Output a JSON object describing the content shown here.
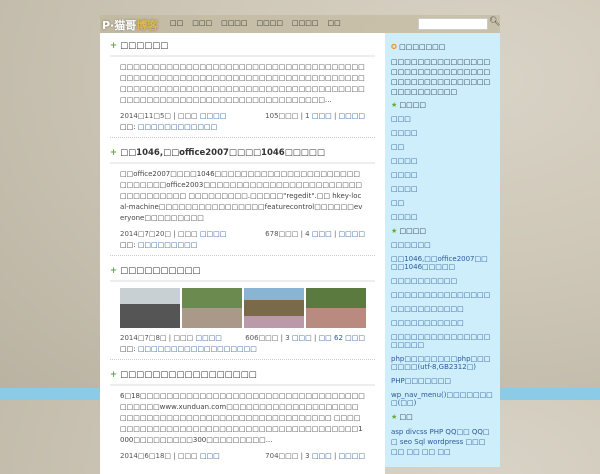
{
  "header": {
    "logo_left": "P·猫哥",
    "logo_right": "博客",
    "nav": [
      "□□",
      "□□□",
      "□□□□",
      "□□□□",
      "□□□□",
      "□□"
    ],
    "search_placeholder": ""
  },
  "posts": [
    {
      "title": "□□□□□□",
      "body": "□□□□□□□□□□□□□□□□□□□□□□□□□□□□□□□□□□□□□□□□□□□□□□□□□□□□□□□□□□□□□□□□□□□□□□□□□□□□□□□□□□□□□□□□□□□□□□□□□□□□□□□□□□□□□□□□□□□□□□□□□□□□□□□□□□□□□□□□□□□□□□...",
      "date": "2014□11□5□ | □□□ ",
      "author": "□□□□",
      "stats": "105□□□ | 1 ",
      "c1": "□□□",
      "c2": "□□□□",
      "tags_label": "□□: ",
      "tags": "□□□□□□□□□□□□"
    },
    {
      "title": "□□1046,□□office2007□□□□1046□□□□□",
      "body": "□□office2007□□□□1046□□□□□□□□□□□□□□□□□□□□□□□□□□□□□office2003□□□□□□□□□□□□□□□□□□□□□□□□□□□□□□□□□□ □□□□□□□□□.□□□□□\"regedit\".□□ hkey-local-machine□□□□□□□□□□□□□□□□featurecontrol□□□□□□everyone□□□□□□□□□",
      "date": "2014□7□20□ | □□□ ",
      "author": "□□□□",
      "stats": "678□□□ | 4 ",
      "c1": "□□□",
      "c2": "□□□□",
      "tags_label": "□□: ",
      "tags": "□□□□□□□□□"
    },
    {
      "title": "□□□□□□□□□□",
      "date": "2014□7□8□ | □□□ ",
      "author": "□□□□",
      "stats": "606□□□ | 3 ",
      "c1": "□□□",
      "c2": "□□ 62 □□□",
      "tags_label": "□□: ",
      "tags": "□□□□□□□□□□□□□□□□□□"
    },
    {
      "title": "□□□□□□□□□□□□□□□□□",
      "body": "6□18□□□□□□□□□□□□□□□□□□□□□□□□□□□□□□□□□□□□□□□□www.xunduan.com□□□□□□□□□□□□□□□□□□□□□□□□□□□□□□□□□□□□□□□□□□□□□□□□□□□□ □□□□□□□□□□□□□□□□□□□□□□□□□□□□□□□□□□□□□□□□1000□□□□□□□□□300□□□□□□□□□...",
      "date": "2014□6□18□ | □□□ ",
      "author": "□□□",
      "stats": "704□□□ | 3 ",
      "c1": "□□□",
      "c2": "□□□□"
    }
  ],
  "sidebar": {
    "notice_title": "□□□□□□□",
    "notice": "□□□□□□□□□□□□□□□□□□□□□□□□□□□□□□□□□□□□□□□□□□□□□□□□□□□□□□□",
    "cat_title": "□□□□",
    "categories": [
      "□□□",
      "□□□□",
      "□□",
      "□□□□",
      "□□□□",
      "□□□□",
      "□□",
      "□□□□"
    ],
    "recent_title": "□□□□",
    "recent": [
      "□□□□□□",
      "□□1046,□□office2007□□□□1046□□□□□",
      "□□□□□□□□□□",
      "□□□□□□□□□□□□□□□",
      "□□□□□□□□□□□",
      "□□□□□□□□□□□",
      "□□□□□□□□□□□□□□□□□□□□",
      "php□□□□□□□□php□□□□□□□(utf-8,GB2312□)",
      "PHP□□□□□□□",
      "wp_nav_menu()□□□□□□□□(□□)"
    ],
    "tags_title": "□□",
    "tags": "asp divcss PHP QQ□□ QQ□□ seo Sql wordpress □□□ □□ □□ □□ □□"
  }
}
